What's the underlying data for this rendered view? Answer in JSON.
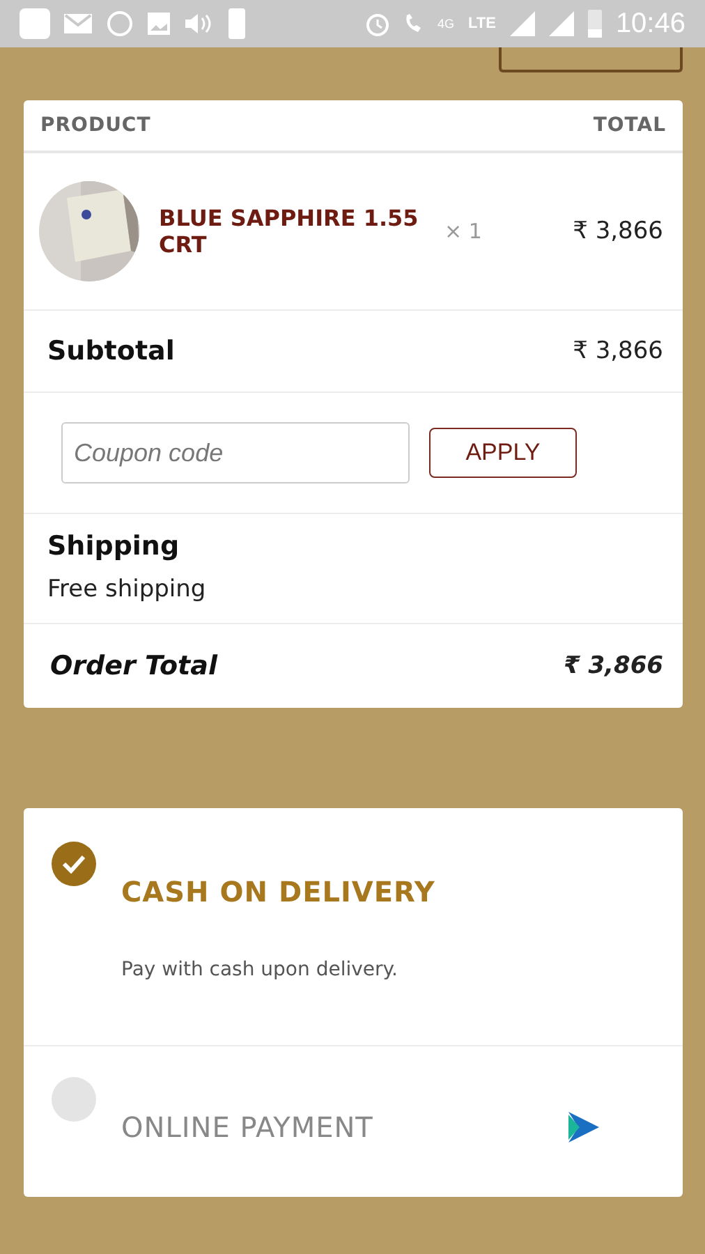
{
  "status_bar": {
    "network": "4G",
    "network_type": "LTE",
    "time": "10:46"
  },
  "order": {
    "columns": [
      "PRODUCT",
      "TOTAL"
    ],
    "items": [
      {
        "name": "BLUE SAPPHIRE 1.55 CRT",
        "quantity": "× 1",
        "total": "₹ 3,866"
      }
    ],
    "subtotal": {
      "label": "Subtotal",
      "value": "₹ 3,866"
    },
    "coupon": {
      "placeholder": "Coupon code",
      "button": "APPLY"
    },
    "shipping": {
      "label": "Shipping",
      "value": "Free shipping"
    },
    "total": {
      "label": "Order Total",
      "value": "₹ 3,866"
    }
  },
  "payment_methods": [
    {
      "title": "CASH ON DELIVERY",
      "selected": true,
      "description": "Pay with cash upon delivery."
    },
    {
      "title": "ONLINE PAYMENT",
      "selected": false,
      "logo": true
    }
  ]
}
